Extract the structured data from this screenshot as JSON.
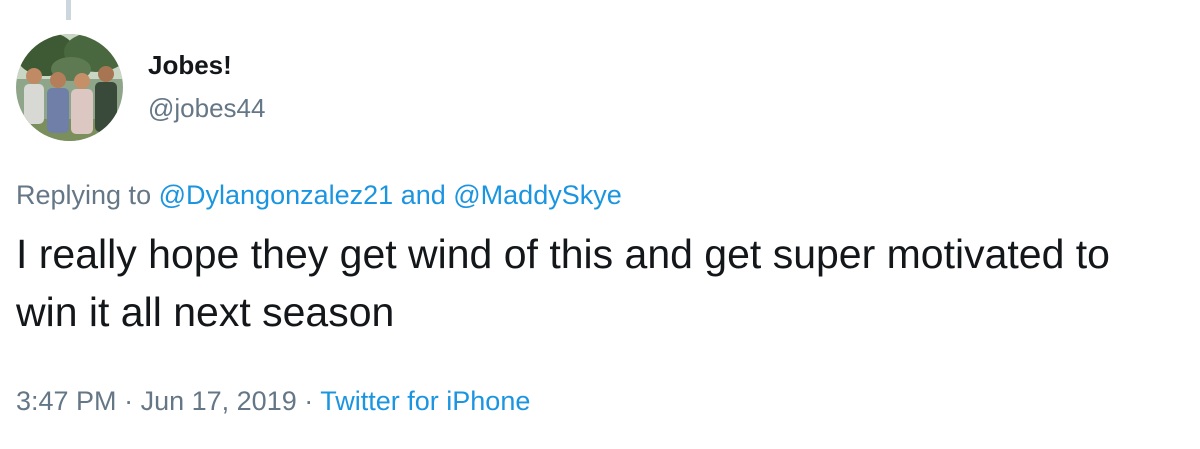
{
  "author": {
    "display_name": "Jobes!",
    "handle": "@jobes44",
    "avatar_icon": "group-photo-avatar"
  },
  "reply": {
    "prefix": "Replying to",
    "mention_1": "@Dylangonzalez21",
    "conjunction": "and",
    "mention_2": "@MaddySkye"
  },
  "tweet": {
    "text": "I really hope they get wind of this and get super motivated to win it all next season"
  },
  "meta": {
    "time": "3:47 PM",
    "separator_1": "·",
    "date": "Jun 17, 2019",
    "separator_2": "·",
    "source": "Twitter for iPhone"
  },
  "colors": {
    "text": "#14171a",
    "secondary": "#657786",
    "link": "#1b95e0",
    "thread_line": "#ccd6dd"
  }
}
